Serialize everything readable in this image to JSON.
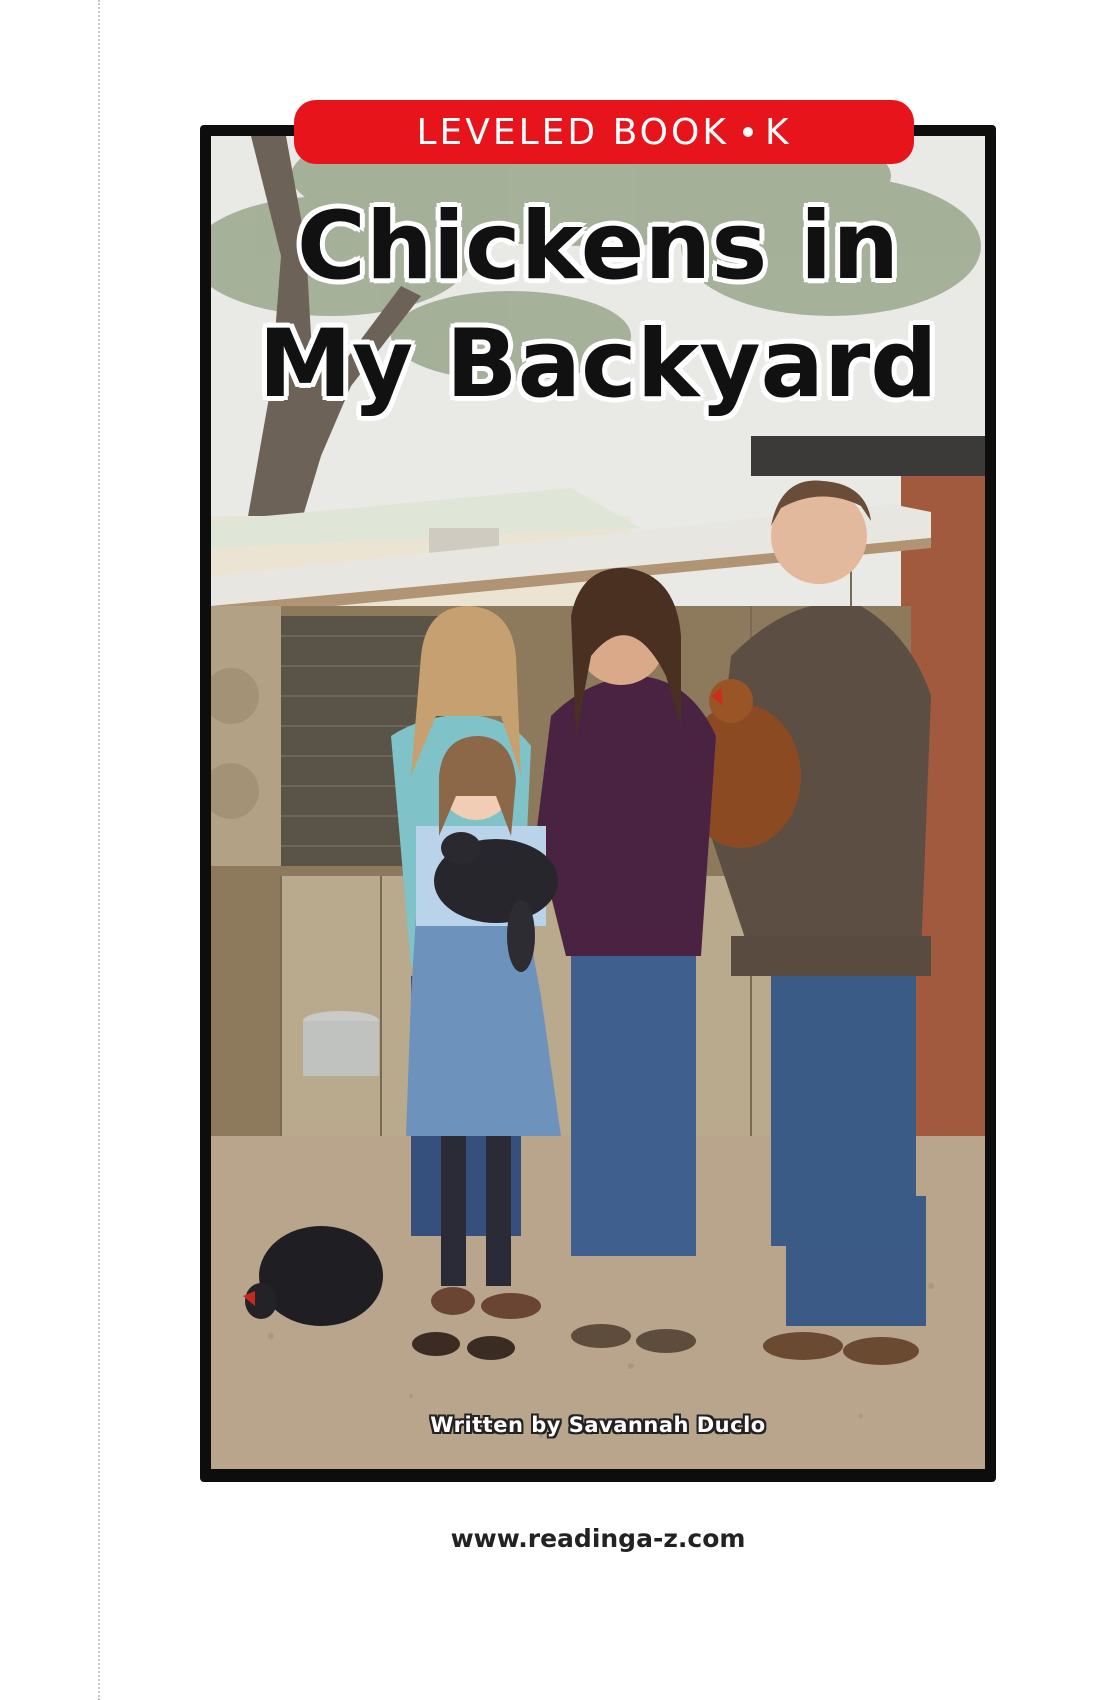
{
  "cover": {
    "level_label": "LEVELED BOOK",
    "level_letter": "K",
    "title_line_1": "Chickens in",
    "title_line_2": "My Backyard",
    "author_line": "Written by Savannah Duclo",
    "badge_color": "#e8141b"
  },
  "footer": {
    "url": "www.readinga-z.com"
  },
  "photo": {
    "icon": "family-with-chickens-photo"
  }
}
